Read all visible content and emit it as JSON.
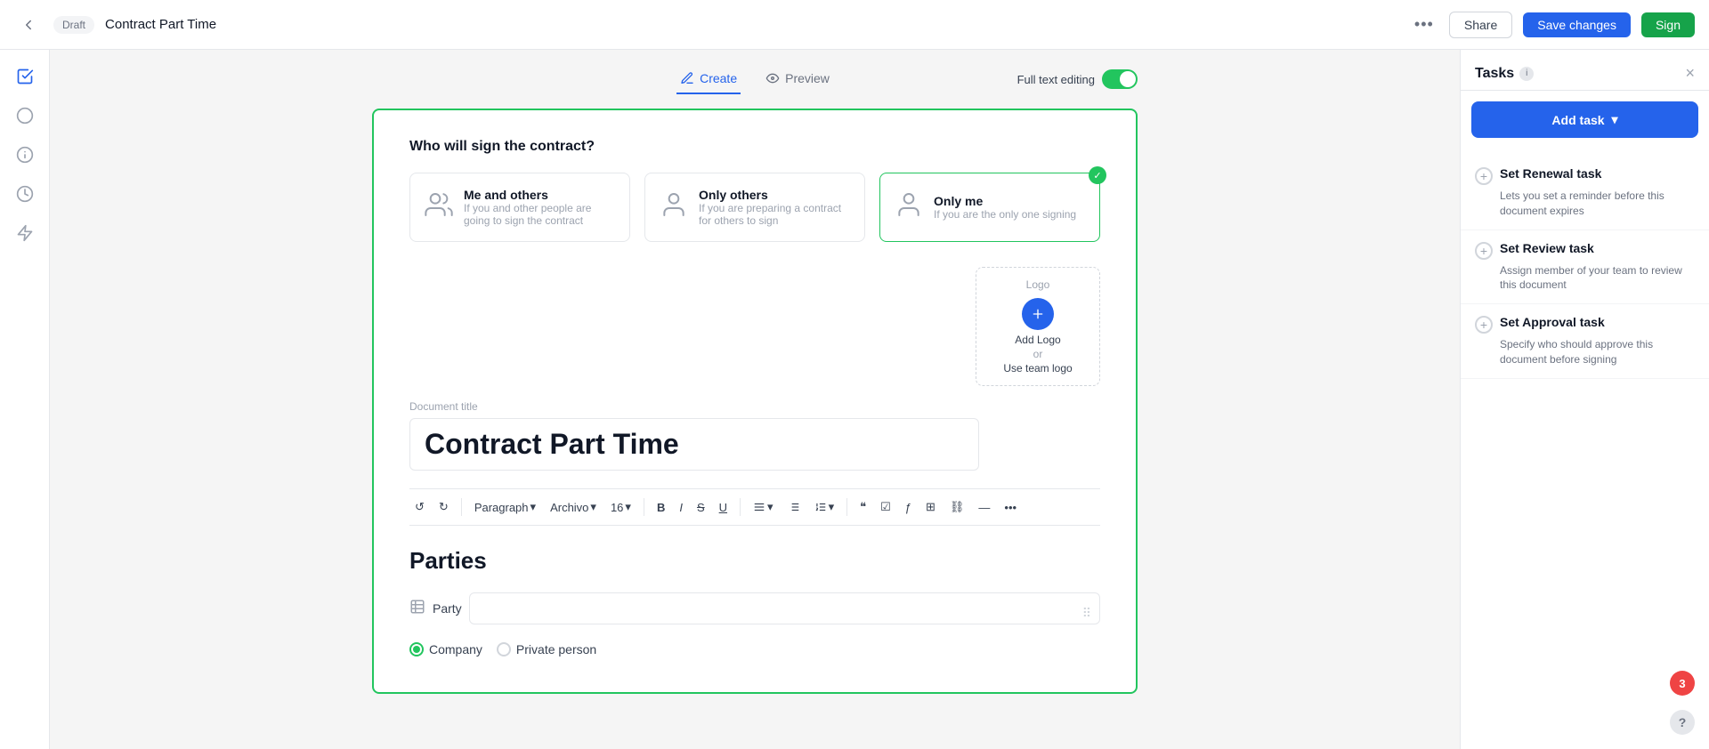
{
  "topbar": {
    "back_label": "←",
    "badge_label": "Draft",
    "title": "Contract Part Time",
    "more_icon": "•••",
    "share_label": "Share",
    "save_label": "Save changes",
    "sign_label": "Sign"
  },
  "tabs": {
    "create_label": "Create",
    "preview_label": "Preview",
    "full_text_label": "Full text editing"
  },
  "sign_options": [
    {
      "id": "me-and-others",
      "title": "Me and others",
      "desc": "If you and other people are going to sign the contract",
      "icon": "👥",
      "selected": false
    },
    {
      "id": "only-others",
      "title": "Only others",
      "desc": "If you are preparing a contract for others to sign",
      "icon": "👤",
      "selected": false
    },
    {
      "id": "only-me",
      "title": "Only me",
      "desc": "If you are the only one signing",
      "icon": "🙋",
      "selected": true
    }
  ],
  "sign_question": "Who will sign the contract?",
  "logo_area": {
    "placeholder": "Logo",
    "add_logo": "Add Logo",
    "or_text": "or",
    "use_team": "Use team logo"
  },
  "document": {
    "title_label": "Document title",
    "title_value": "Contract Part Time",
    "section_heading": "Parties",
    "party_label": "Party"
  },
  "radio_options": {
    "company": "Company",
    "private": "Private person"
  },
  "toolbar": {
    "paragraph_label": "Paragraph",
    "font_label": "Archivo",
    "size_label": "16",
    "bold": "B",
    "italic": "I",
    "strikethrough": "S",
    "underline": "U"
  },
  "tasks_panel": {
    "title": "Tasks",
    "close_icon": "×",
    "add_task_label": "Add task",
    "tasks": [
      {
        "id": "renewal",
        "title": "Set Renewal task",
        "desc": "Lets you set a reminder before this document expires"
      },
      {
        "id": "review",
        "title": "Set Review task",
        "desc": "Assign member of your team to review this document"
      },
      {
        "id": "approval",
        "title": "Set Approval task",
        "desc": "Specify who should approve this document before signing"
      }
    ]
  },
  "notification_badge": "3",
  "help_label": "?"
}
